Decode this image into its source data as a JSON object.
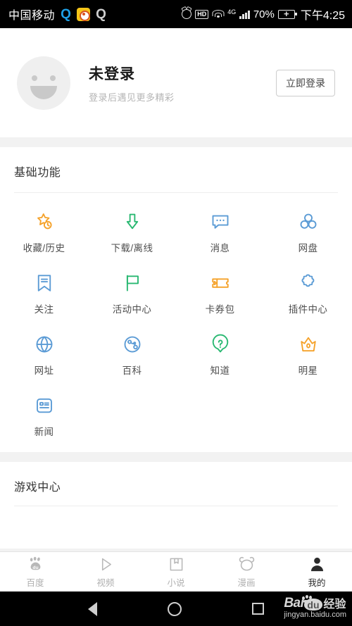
{
  "statusbar": {
    "carrier": "中国移动",
    "app_icons": [
      "qq-icon",
      "weibo-icon",
      "qq-grey-icon"
    ],
    "alarm_icon": "alarm-icon",
    "hd_label": "HD",
    "wifi_icon": "wifi-icon",
    "network_label": "4G",
    "signal_icon": "signal-bars-icon",
    "battery_percent": "70%",
    "battery_icon": "battery-charging-icon",
    "time": "下午4:25"
  },
  "profile": {
    "avatar_icon": "smiley-avatar-icon",
    "name": "未登录",
    "subtitle": "登录后遇见更多精彩",
    "login_button": "立即登录"
  },
  "basic": {
    "title": "基础功能",
    "items": [
      {
        "label": "收藏/历史",
        "icon": "star-clock-icon",
        "color": "#f5a22a"
      },
      {
        "label": "下载/离线",
        "icon": "download-arrow-icon",
        "color": "#28b871"
      },
      {
        "label": "消息",
        "icon": "chat-bubble-icon",
        "color": "#5b9bd5"
      },
      {
        "label": "网盘",
        "icon": "cloud-disk-icon",
        "color": "#5b9bd5"
      },
      {
        "label": "关注",
        "icon": "bookmark-icon",
        "color": "#5b9bd5"
      },
      {
        "label": "活动中心",
        "icon": "flag-icon",
        "color": "#28b871"
      },
      {
        "label": "卡券包",
        "icon": "ticket-icon",
        "color": "#f5a22a"
      },
      {
        "label": "插件中心",
        "icon": "puzzle-piece-icon",
        "color": "#5b9bd5"
      },
      {
        "label": "网址",
        "icon": "globe-icon",
        "color": "#5b9bd5"
      },
      {
        "label": "百科",
        "icon": "planet-icon",
        "color": "#5b9bd5"
      },
      {
        "label": "知道",
        "icon": "question-mark-icon",
        "color": "#28b871"
      },
      {
        "label": "明星",
        "icon": "crown-icon",
        "color": "#f5a22a"
      },
      {
        "label": "新闻",
        "icon": "news-card-icon",
        "color": "#5b9bd5"
      }
    ]
  },
  "game": {
    "title": "游戏中心"
  },
  "tabbar": {
    "tabs": [
      {
        "label": "百度",
        "icon": "baidu-paw-icon",
        "active": false
      },
      {
        "label": "视频",
        "icon": "play-icon",
        "active": false
      },
      {
        "label": "小说",
        "icon": "book-icon",
        "active": false
      },
      {
        "label": "漫画",
        "icon": "bear-face-icon",
        "active": false
      },
      {
        "label": "我的",
        "icon": "person-icon",
        "active": true
      }
    ]
  },
  "navbar": {
    "back_icon": "back-triangle-icon",
    "home_icon": "home-circle-icon",
    "recents_icon": "recents-square-icon"
  },
  "watermark": {
    "brand": "Bai",
    "du": "du",
    "suffix": "经验",
    "url": "jingyan.baidu.com"
  }
}
